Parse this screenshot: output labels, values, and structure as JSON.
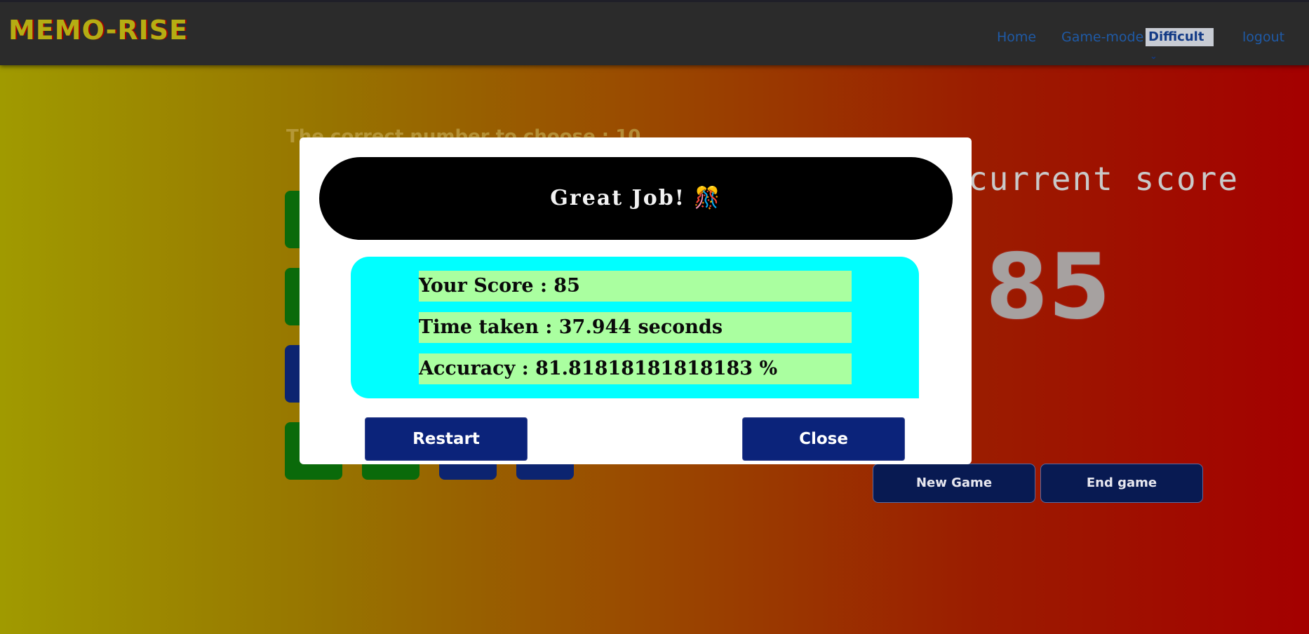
{
  "nav": {
    "logo": "MEMO-RISE",
    "home": "Home",
    "game_mode_label": "Game-mode :",
    "game_mode_value": "Difficult",
    "logout": "logout"
  },
  "game": {
    "prompt": "The correct number to choose : 10",
    "score_label": "current score",
    "score_value": "85",
    "new_game": "New Game",
    "end_game": "End game"
  },
  "modal": {
    "title": "Great Job! 🎊",
    "score": "Your Score : 85",
    "time": "Time taken : 37.944 seconds",
    "accuracy": "Accuracy : 81.81818181818183 %",
    "restart": "Restart",
    "close": "Close"
  },
  "colors": {
    "tile_green": "#0a6a0a",
    "tile_blue": "#0c2470",
    "modal_stats_bg": "#00ffff",
    "stat_row_bg": "#aaffa0",
    "button_bg": "#0b237a"
  }
}
